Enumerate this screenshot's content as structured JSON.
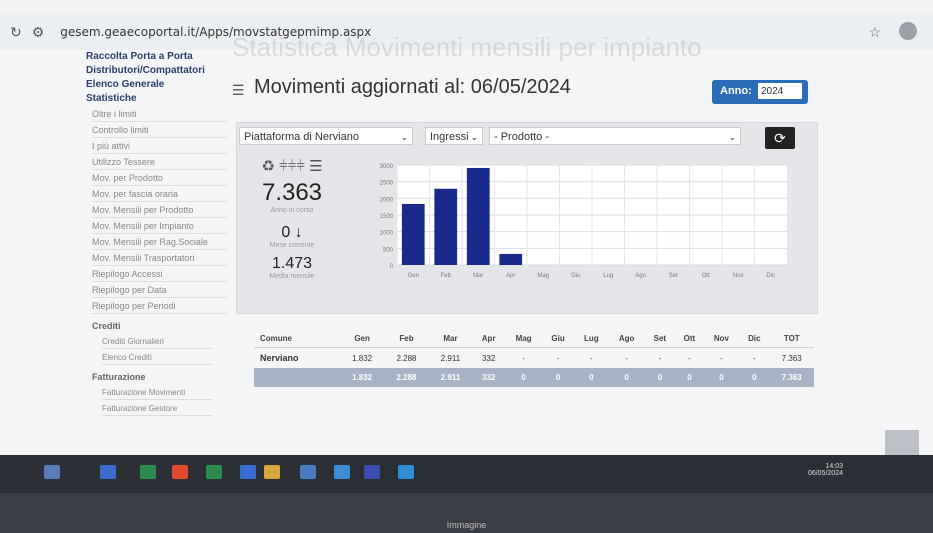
{
  "browser": {
    "url": "gesem.geaecoportal.it/Apps/movstatgepmimp.aspx"
  },
  "ghost_title": "Statistica Movimenti mensili per impianto",
  "sidebar": {
    "heads": [
      "Raccolta Porta a Porta",
      "Distributori/Compattatori",
      "Elenco Generale",
      "Statistiche"
    ],
    "stat_items": [
      "Oltre i limiti",
      "Controllo limiti",
      "I più attivi",
      "Utilizzo Tessere",
      "Mov. per Prodotto",
      "Mov. per fascia oraria",
      "Mov. Mensili per Prodotto",
      "Mov. Mensili per Impianto",
      "Mov. Mensili per Rag.Sociale",
      "Mov. Mensili Trasportatori",
      "Riepilogo Accessi",
      "Riepilogo per Data",
      "Riepilogo per Periodi"
    ],
    "crediti": {
      "title": "Crediti",
      "items": [
        "Crediti Giornalieri",
        "Elenco Crediti"
      ]
    },
    "fatturazione": {
      "title": "Fatturazione",
      "items": [
        "Fatturazione Movimenti",
        "Fatturazione Gestore"
      ]
    }
  },
  "header": {
    "title": "Movimenti aggiornati al: 06/05/2024",
    "anno_label": "Anno:",
    "anno_value": "2024"
  },
  "filters": {
    "piattaforma": "Piattaforma di Nerviano",
    "tipo": "Ingressi",
    "prodotto": "- Prodotto -"
  },
  "stats": {
    "icons": "♻ ⫩⫩⫩ ☰",
    "anno_value": "7.363",
    "anno_label": "Anno in corso",
    "mese_value": "0 ↓",
    "mese_label": "Mese corrente",
    "media_value": "1.473",
    "media_label": "Media mensile"
  },
  "chart_data": {
    "type": "bar",
    "categories": [
      "Gen",
      "Feb",
      "Mar",
      "Apr",
      "Mag",
      "Giu",
      "Lug",
      "Ago",
      "Set",
      "Ott",
      "Nov",
      "Dic"
    ],
    "values": [
      1832,
      2288,
      2911,
      332,
      0,
      0,
      0,
      0,
      0,
      0,
      0,
      0
    ],
    "ylim": [
      0,
      3000
    ],
    "yticks": [
      0,
      500,
      1000,
      1500,
      2000,
      2500,
      3000
    ],
    "grid": true,
    "bar_color": "#1a2a8c"
  },
  "table": {
    "headers": [
      "Comune",
      "Gen",
      "Feb",
      "Mar",
      "Apr",
      "Mag",
      "Giu",
      "Lug",
      "Ago",
      "Set",
      "Ott",
      "Nov",
      "Dic",
      "TOT"
    ],
    "row": [
      "Nerviano",
      "1.832",
      "2.288",
      "2.911",
      "332",
      "-",
      "-",
      "-",
      "-",
      "-",
      "-",
      "-",
      "-",
      "7.363"
    ],
    "total": [
      "",
      "1.832",
      "2.288",
      "2.911",
      "332",
      "0",
      "0",
      "0",
      "0",
      "0",
      "0",
      "0",
      "0",
      "7.363"
    ]
  },
  "taskbar": {
    "time": "14:03",
    "date": "06/05/2024"
  },
  "caption": "Immagine"
}
